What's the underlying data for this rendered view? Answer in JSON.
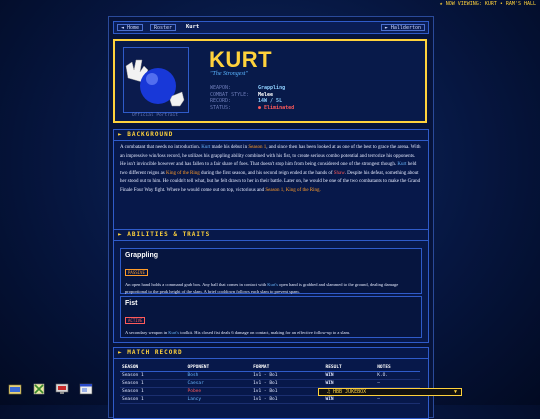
{
  "ticker": "★ NOW VIEWING: KURT • RAM'S HALL",
  "nav": {
    "home": "◄ Home",
    "roster": "Roster",
    "current": "Kurt",
    "next": "► Hallderton"
  },
  "profile": {
    "name": "KURT",
    "tagline": "\"The Strongest\"",
    "caption": "Official Portrait",
    "stats": [
      {
        "key": "WEAPON:",
        "value": "Grappling"
      },
      {
        "key": "COMBAT STYLE:",
        "value": "Melee"
      },
      {
        "key": "RECORD:",
        "value": "14W / 5L"
      },
      {
        "key": "STATUS:",
        "value": "● Eliminated"
      }
    ]
  },
  "background": {
    "heading": "► BACKGROUND",
    "text_1": "A combatant that needs no introduction.",
    "name_1": "Kurt",
    "text_2": "made his debut in",
    "season_1": "Season 1",
    "text_3": ", and since then has been looked at as one of the best to grace the arena. With an impressive win/loss record, he utilizes his grappling ability combined with his fist, to create serious combo potential and terrorize his opponents. He isn't invincible however and has fallen to a fair share of foes. That doesn't stop him from being considered one of the strongest though.",
    "name_2": "Kurt",
    "text_4": "held two different reigns as",
    "king": "King of the Ring",
    "text_5": "during the first season, and his second reign ended at the hands of",
    "shaw": "Shaw",
    "text_6": ". Despite his defeat, something about her stood out to him. He couldn't tell what, but he felt drawn to her in their battle. Later on, he would be one of the two combatants to make the Grand Finale Four Way fight. Where he would come out on top, victorious and",
    "king_2": "Season 1, King of the Ring."
  },
  "abilities": {
    "heading": "► ABILITIES & TRAITS",
    "items": [
      {
        "title": "Grappling",
        "tag": "PASSIVE",
        "desc_1": "An open hand holds a command grab box. Any ball that comes in contact with",
        "name": "Kurt's",
        "desc_2": "open hand is grabbed and slammed to the ground, dealing damage proportional to the peak height of the slam. A brief cooldown follows each slam to prevent spam."
      },
      {
        "title": "Fist",
        "tag": "ACTIVE",
        "desc_1": "A secondary weapon in",
        "name": "Kurt's",
        "desc_2": "toolkit. His closed fist deals 6 damage on contact, making for an effective follow-up to a slam."
      }
    ]
  },
  "match_record": {
    "heading": "► MATCH RECORD",
    "columns": [
      "SEASON",
      "OPPONENT",
      "FORMAT",
      "RESULT",
      "NOTES"
    ],
    "rows": [
      {
        "season": "Season 1",
        "opponent": "Bosh",
        "format": "1v1 - Bo1",
        "result": "WIN",
        "notes": "K.O."
      },
      {
        "season": "Season 1",
        "opponent": "Caesar",
        "format": "1v1 - Bo1",
        "result": "WIN",
        "notes": "—"
      },
      {
        "season": "Season 1",
        "opponent": "Pobee",
        "format": "1v1 - Bo1",
        "result": "LOSS",
        "notes": "—"
      },
      {
        "season": "Season 1",
        "opponent": "Lancy",
        "format": "1v1 - Bo1",
        "result": "WIN",
        "notes": "—"
      }
    ]
  },
  "jukebox": {
    "label": "♫ HBB JUKEBOX",
    "arrow": "▼"
  },
  "desktop_icons": [
    "folder-icon",
    "tools-icon",
    "monitor-icon",
    "window-icon"
  ]
}
